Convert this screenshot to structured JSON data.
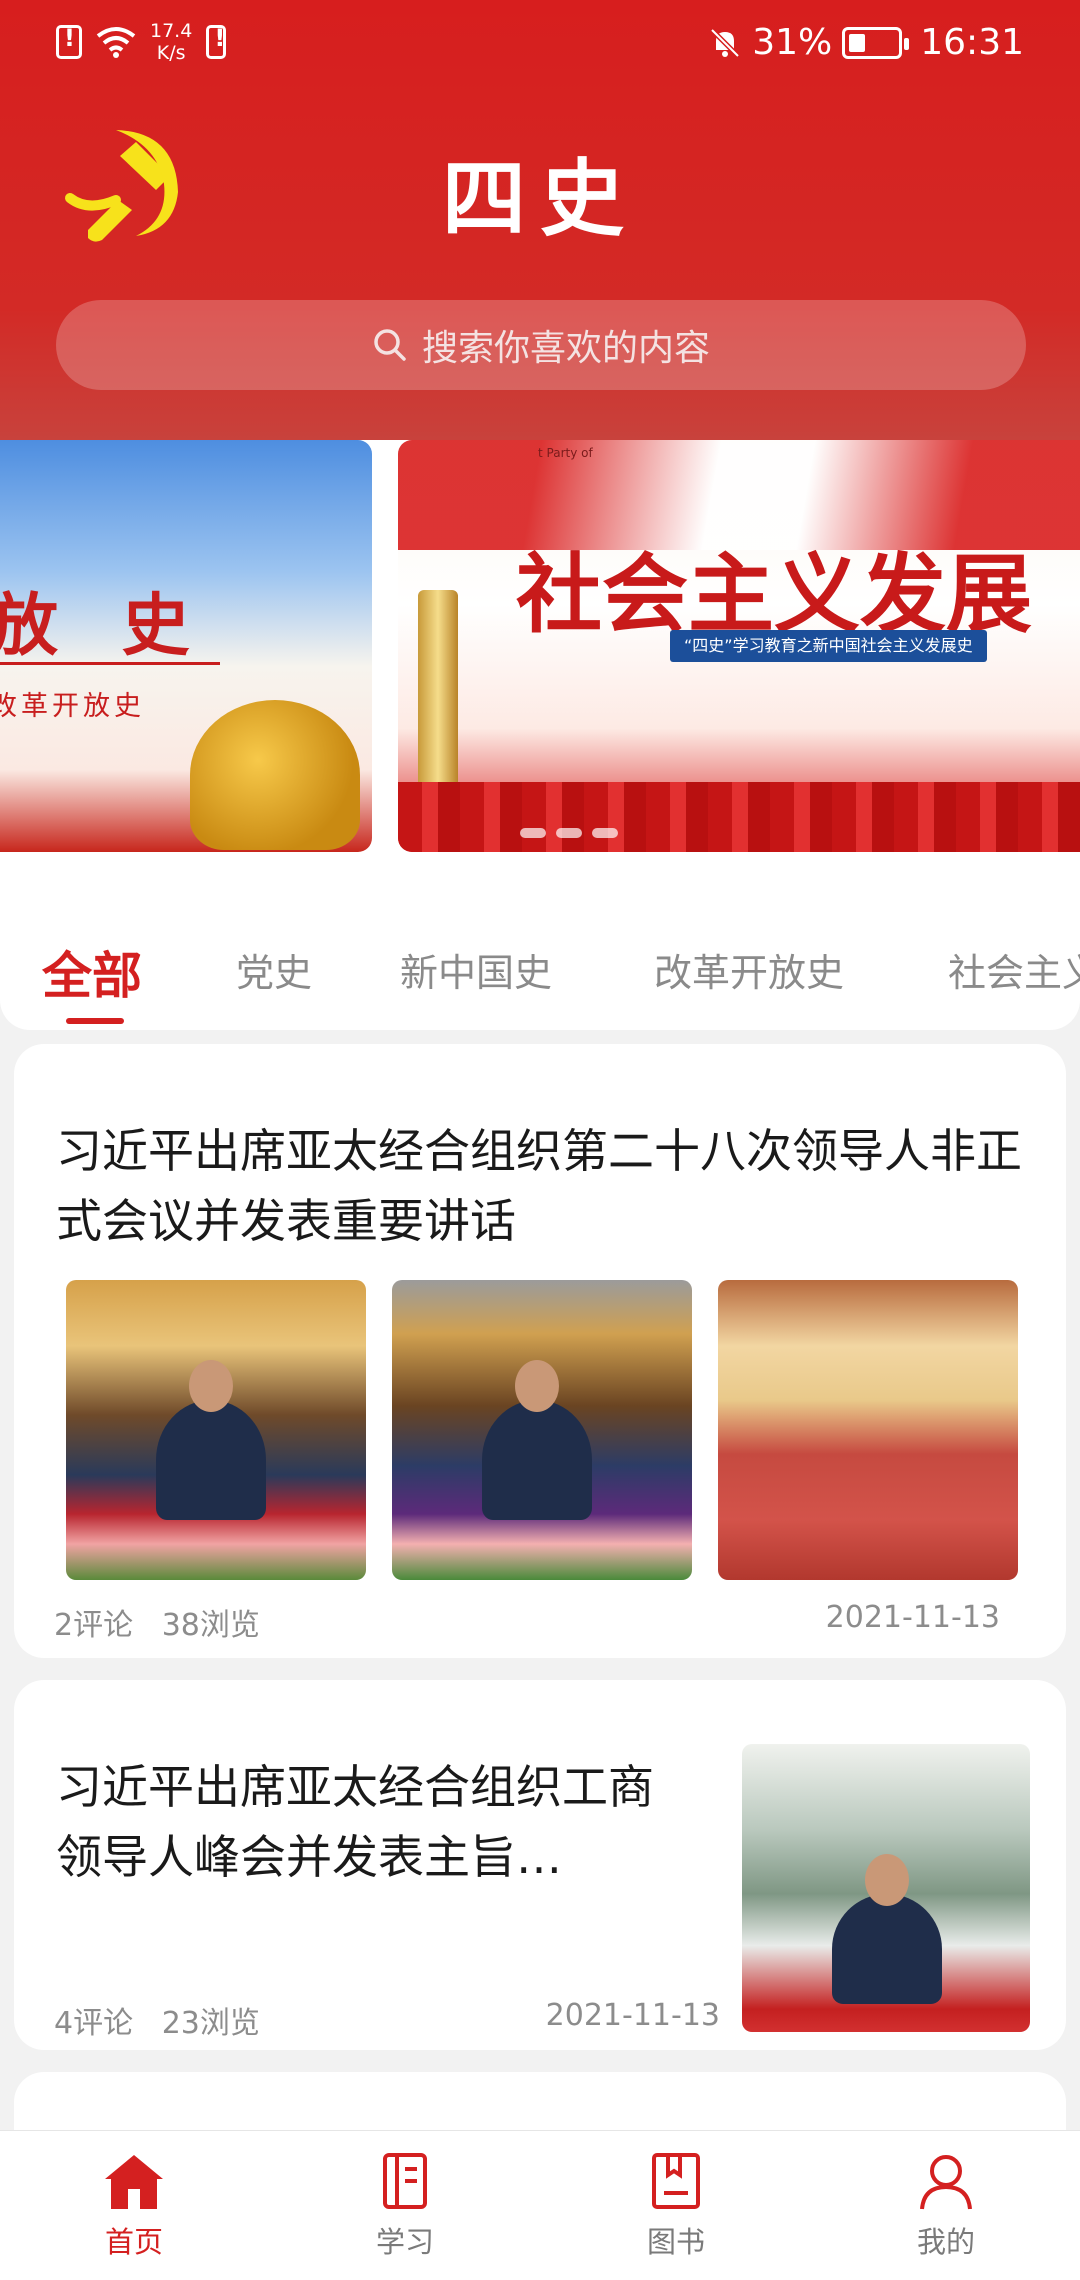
{
  "status_bar": {
    "network_speed": "17.4\nK/s",
    "battery_percent": "31%",
    "time": "16:31"
  },
  "app": {
    "title": "四史"
  },
  "search": {
    "placeholder": "搜索你喜欢的内容"
  },
  "carousel": {
    "slides": [
      {
        "title": "放 史",
        "subtitle": "改革开放史"
      },
      {
        "title": "社会主义发展",
        "subtitle": "“四史”学习教育之新中国社会主义发展史",
        "tag": "t Party of"
      }
    ],
    "slide_count": 3
  },
  "tabs": [
    {
      "label": "全部",
      "active": true
    },
    {
      "label": "党史",
      "active": false
    },
    {
      "label": "新中国史",
      "active": false
    },
    {
      "label": "改革开放史",
      "active": false
    },
    {
      "label": "社会主义",
      "active": false
    }
  ],
  "articles": [
    {
      "title": "习近平出席亚太经合组织第二十八次领导人非正式会议并发表重要讲话",
      "comments": "2评论",
      "views": "38浏览",
      "date": "2021-11-13"
    },
    {
      "title": "习近平出席亚太经合组织工商领导人峰会并发表主旨…",
      "comments": "4评论",
      "views": "23浏览",
      "date": "2021-11-13"
    }
  ],
  "bottom_nav": [
    {
      "label": "首页",
      "icon": "home-icon",
      "active": true
    },
    {
      "label": "学习",
      "icon": "study-icon",
      "active": false
    },
    {
      "label": "图书",
      "icon": "book-icon",
      "active": false
    },
    {
      "label": "我的",
      "icon": "profile-icon",
      "active": false
    }
  ],
  "colors": {
    "primary": "#d42020",
    "header": "#d71e1e",
    "text": "#1a1a1a",
    "muted": "#8c8c8c"
  }
}
